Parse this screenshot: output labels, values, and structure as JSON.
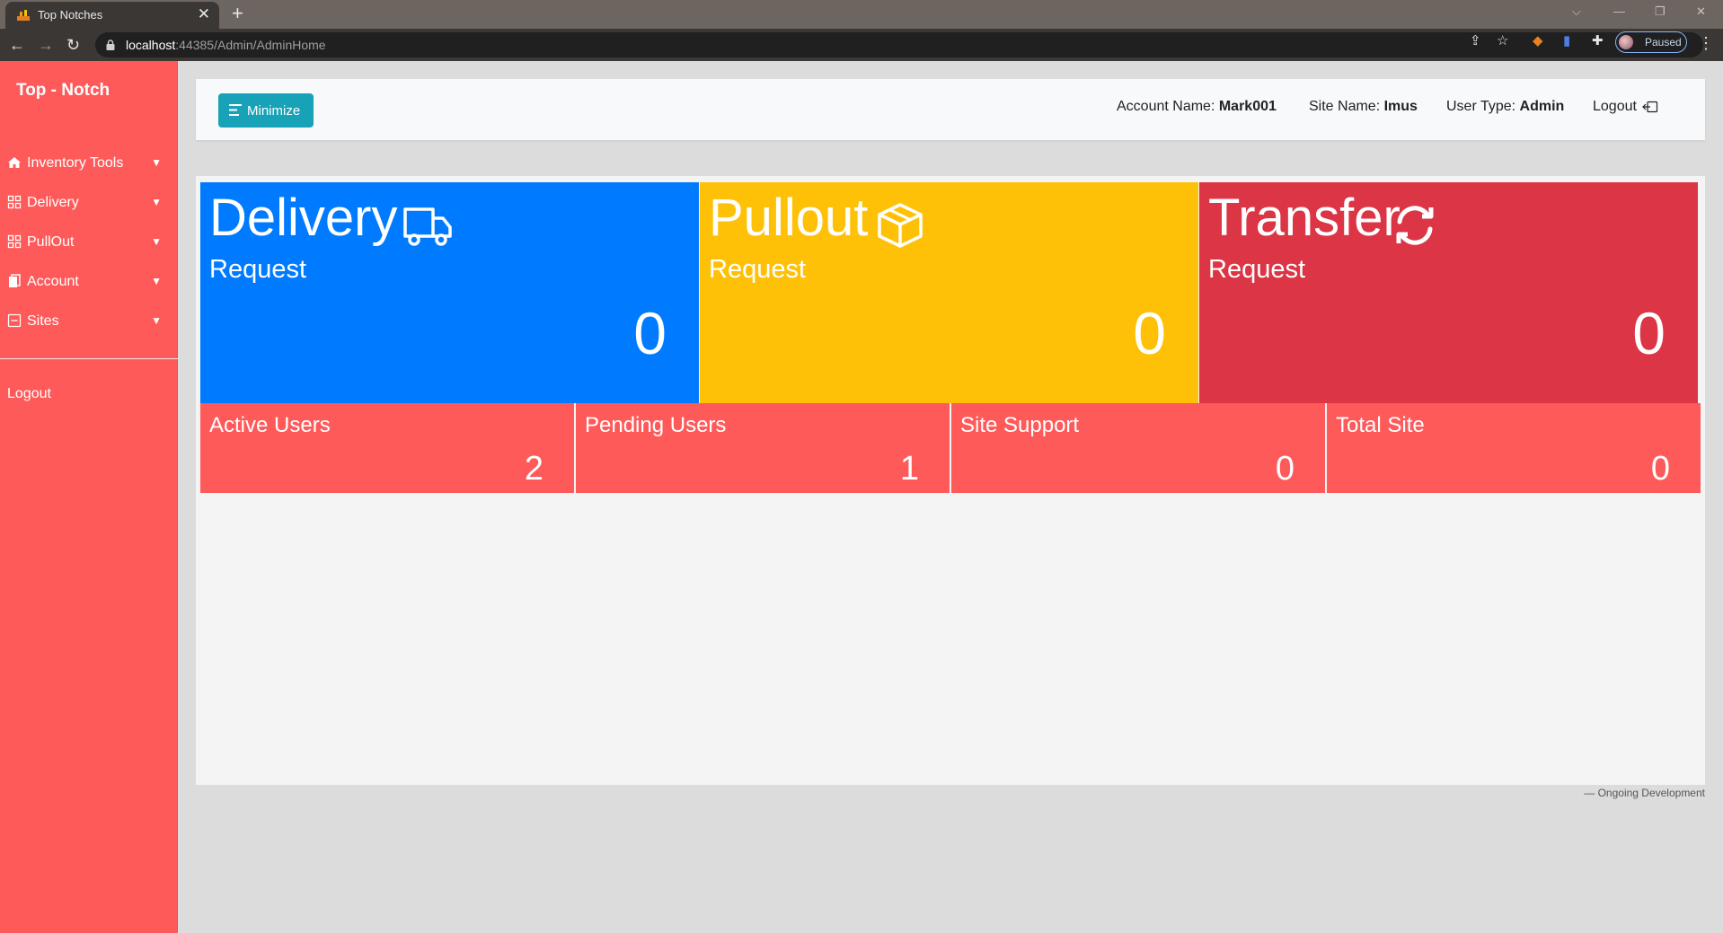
{
  "browser": {
    "tab_title": "Top Notches",
    "tab_close": "✕",
    "new_tab": "+",
    "url_host": "localhost",
    "url_rest": ":44385/Admin/AdminHome",
    "profile_label": "Paused"
  },
  "sidebar": {
    "brand": "Top - Notch",
    "items": [
      {
        "label": "Inventory Tools",
        "icon": "home-icon"
      },
      {
        "label": "Delivery",
        "icon": "grid-icon"
      },
      {
        "label": "PullOut",
        "icon": "grid-icon"
      },
      {
        "label": "Account",
        "icon": "documents-icon"
      },
      {
        "label": "Sites",
        "icon": "square-minus-icon"
      }
    ],
    "logout": "Logout"
  },
  "header": {
    "minimize_label": "Minimize",
    "account_label": "Account Name:",
    "account_value": "Mark001",
    "site_label": "Site Name:",
    "site_value": "Imus",
    "usertype_label": "User Type:",
    "usertype_value": "Admin",
    "logout_label": "Logout"
  },
  "cards": [
    {
      "title": "Delivery",
      "subtitle": "Request",
      "count": "0",
      "color": "#007bff",
      "icon": "truck-icon"
    },
    {
      "title": "Pullout",
      "subtitle": "Request",
      "count": "0",
      "color": "#ffc107",
      "icon": "box-icon"
    },
    {
      "title": "Transfer",
      "subtitle": "Request",
      "count": "0",
      "color": "#dc3545",
      "icon": "refresh-icon"
    }
  ],
  "stats": [
    {
      "label": "Active Users",
      "value": "2"
    },
    {
      "label": "Pending Users",
      "value": "1"
    },
    {
      "label": "Site Support",
      "value": "0"
    },
    {
      "label": "Total Site",
      "value": "0"
    }
  ],
  "stats_color": "#ff5a5a",
  "footer_note": "— Ongoing Development"
}
